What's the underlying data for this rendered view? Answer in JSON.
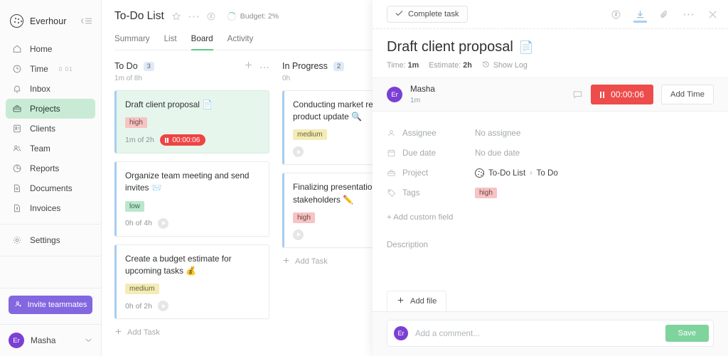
{
  "sidebar": {
    "brand": "Everhour",
    "collapse_icon": "collapse-icon",
    "items": [
      {
        "label": "Home",
        "icon": "home-icon",
        "badge": ""
      },
      {
        "label": "Time",
        "icon": "clock-icon",
        "badge": "0 01"
      },
      {
        "label": "Inbox",
        "icon": "bell-icon",
        "badge": ""
      },
      {
        "label": "Projects",
        "icon": "briefcase-icon",
        "badge": "",
        "active": true
      },
      {
        "label": "Clients",
        "icon": "id-card-icon",
        "badge": ""
      },
      {
        "label": "Team",
        "icon": "people-icon",
        "badge": ""
      },
      {
        "label": "Reports",
        "icon": "pie-chart-icon",
        "badge": ""
      },
      {
        "label": "Documents",
        "icon": "document-icon",
        "badge": ""
      },
      {
        "label": "Invoices",
        "icon": "invoice-icon",
        "badge": ""
      }
    ],
    "settings": {
      "label": "Settings",
      "icon": "gear-icon"
    },
    "invite_label": "Invite teammates",
    "user": {
      "initials": "Er",
      "name": "Masha"
    }
  },
  "header": {
    "project_title": "To-Do List",
    "star_icon": "star-icon",
    "more_icon": "more-horizontal-icon",
    "billing_icon": "dollar-circle-icon",
    "budget_label": "Budget: 2%",
    "budget_percent": 2,
    "tabs": [
      {
        "label": "Summary",
        "active": false
      },
      {
        "label": "List",
        "active": false
      },
      {
        "label": "Board",
        "active": true
      },
      {
        "label": "Activity",
        "active": false
      }
    ]
  },
  "board": {
    "add_task_label": "Add Task",
    "columns": [
      {
        "name": "To Do",
        "count": "3",
        "subtitle": "1m of 8h",
        "add_icon": "plus-icon",
        "more_icon": "more-horizontal-icon",
        "cards": [
          {
            "title": "Draft client proposal",
            "emoji": "📄",
            "tag": "high",
            "tag_kind": "high",
            "time": "1m of 2h",
            "selected": true,
            "timer_running": true,
            "timer_value": "00:00:06"
          },
          {
            "title": "Organize team meeting and send invites",
            "emoji": "📨",
            "tag": "low",
            "tag_kind": "low",
            "time": "0h of 4h",
            "selected": false,
            "timer_running": false,
            "timer_value": ""
          },
          {
            "title": "Create a budget estimate for upcoming tasks",
            "emoji": "💰",
            "tag": "medium",
            "tag_kind": "medium",
            "time": "0h of 2h",
            "selected": false,
            "timer_running": false,
            "timer_value": ""
          }
        ]
      },
      {
        "name": "In Progress",
        "count": "2",
        "subtitle": "0h",
        "add_icon": "plus-icon",
        "more_icon": "more-horizontal-icon",
        "cards": [
          {
            "title": "Conducting market research for product update",
            "emoji": "🔍",
            "tag": "medium",
            "tag_kind": "medium",
            "time": "",
            "selected": false,
            "timer_running": false,
            "timer_value": ""
          },
          {
            "title": "Finalizing presentation for stakeholders",
            "emoji": "✏️",
            "tag": "high",
            "tag_kind": "high",
            "time": "",
            "selected": false,
            "timer_running": false,
            "timer_value": ""
          }
        ]
      }
    ]
  },
  "panel": {
    "complete_label": "Complete task",
    "icons": {
      "billable": "dollar-circle-icon",
      "export": "download-icon",
      "attach": "paperclip-icon",
      "more": "more-horizontal-icon",
      "close": "close-icon"
    },
    "task_title": "Draft client proposal",
    "task_emoji": "📄",
    "time_label": "Time:",
    "time_value": "1m",
    "estimate_label": "Estimate:",
    "estimate_value": "2h",
    "show_log_label": "Show Log",
    "time_row": {
      "initials": "Er",
      "user": "Masha",
      "user_time": "1m",
      "comment_icon": "comment-icon",
      "timer_value": "00:00:06",
      "add_time_label": "Add Time"
    },
    "fields": [
      {
        "label": "Assignee",
        "icon": "person-icon",
        "value": "No assignee",
        "kind": "muted"
      },
      {
        "label": "Due date",
        "icon": "calendar-icon",
        "value": "No due date",
        "kind": "muted"
      },
      {
        "label": "Project",
        "icon": "briefcase-icon",
        "value": "To-Do List",
        "value2": "To Do",
        "kind": "project"
      },
      {
        "label": "Tags",
        "icon": "tag-icon",
        "value": "high",
        "kind": "tag"
      }
    ],
    "add_custom_field": "+ Add custom field",
    "description_placeholder": "Description",
    "add_file_label": "Add file",
    "comment_placeholder": "Add a comment...",
    "comment_initials": "Er",
    "save_label": "Save"
  },
  "colors": {
    "accent_green": "#5ec98a",
    "selected_card": "#e6f6ec",
    "card_border_left": "#a8cdf0",
    "timer_red": "#ee4b4b",
    "purple": "#7b3fd4",
    "invite_purple": "#8267e0",
    "save_green": "#7fd39c"
  }
}
